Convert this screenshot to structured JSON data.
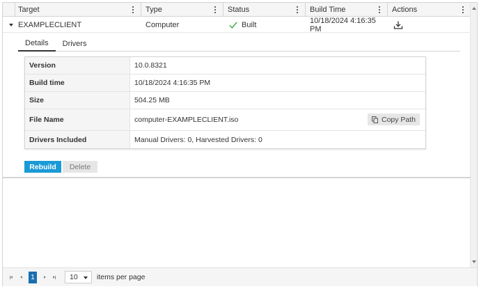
{
  "columns": {
    "target": "Target",
    "type": "Type",
    "status": "Status",
    "build_time": "Build Time",
    "actions": "Actions"
  },
  "row": {
    "target": "EXAMPLECLIENT",
    "type": "Computer",
    "status": "Built",
    "build_time": "10/18/2024 4:16:35 PM"
  },
  "tabs": [
    "Details",
    "Drivers"
  ],
  "details": {
    "version_label": "Version",
    "version": "10.0.8321",
    "build_time_label": "Build time",
    "build_time": "10/18/2024 4:16:35 PM",
    "size_label": "Size",
    "size": "504.25 MB",
    "file_name_label": "File Name",
    "file_name": "computer-EXAMPLECLIENT.iso",
    "copy_path_label": "Copy Path",
    "drivers_label": "Drivers Included",
    "drivers": "Manual Drivers: 0, Harvested Drivers: 0"
  },
  "buttons": {
    "rebuild": "Rebuild",
    "delete": "Delete"
  },
  "pager": {
    "current_page": "1",
    "page_size": "10",
    "page_size_label": "items per page"
  },
  "colors": {
    "accent": "#1a9ad6",
    "page_active": "#1a6fb0",
    "success": "#3aa83a"
  },
  "icons": {
    "status": "check-icon",
    "action": "download-icon",
    "copy": "copy-icon"
  }
}
